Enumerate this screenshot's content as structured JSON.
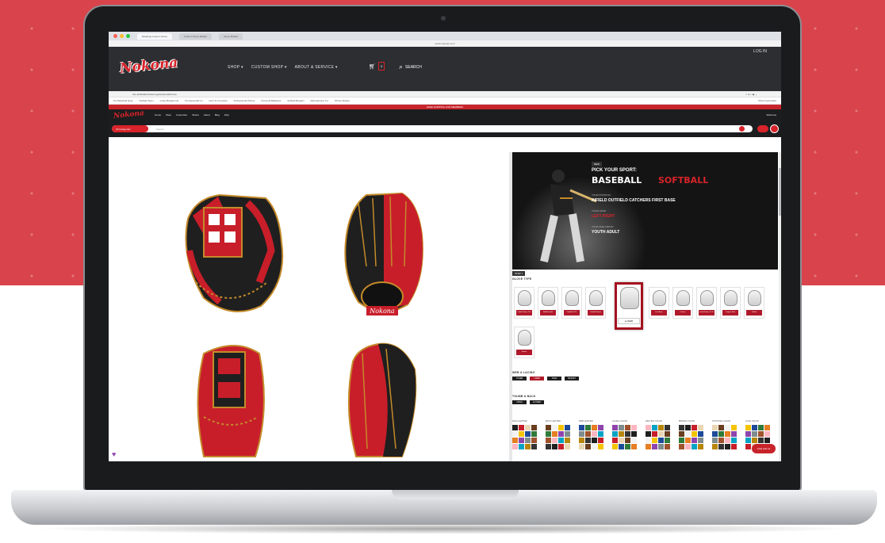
{
  "browser": {
    "tabs": [
      "Rawlings Custom Glove",
      "Custom Glove Builder",
      "Glove Builder"
    ],
    "address_top": "www.example.com",
    "address_bottom": "rdx.net/builder/custom-glove?product=cus",
    "bookmarks": [
      "Pro Baseball Gear",
      "Softball Team",
      "Lucky Bargain Hit",
      "Pro Essential Co",
      "How To Compare",
      "Professional Photos",
      "Personal Ballparks",
      "Softball Bargain",
      "Manufacturer Co",
      "Off the Market"
    ],
    "bookmarks_right": "Other bookmarks"
  },
  "site_header": {
    "logo_text": "Nokona",
    "login": "LOG IN",
    "nav": [
      "SHOP",
      "CUSTOM SHOP",
      "ABOUT & SERVICE"
    ],
    "cart_count": "0",
    "search_label": "SEARCH"
  },
  "promo_bar": "FREE SHIPPING FOR MEMBERS",
  "inner_header": {
    "logo_text": "Nokona",
    "nav": [
      "Home",
      "Shop",
      "Customize",
      "Shorts",
      "About",
      "Blog",
      "FAQ"
    ],
    "account": "Welcome",
    "all_categories": "All Categories",
    "search_placeholder": "Search"
  },
  "banner": {
    "tag": "NEW",
    "pick": "PICK YOUR SPORT:",
    "baseball": "BASEBALL",
    "softball": "SOFTBALL",
    "line1_label": "YOUR POSITION",
    "line1": "INFIELD   OUTFIELD   CATCHERS   FIRST BASE",
    "line2_label": "YOUR HAND",
    "line2": "LEFT  RIGHT",
    "line3_label": "YOUR AGE GROUP",
    "line3": "YOUTH  ADULT"
  },
  "builder": {
    "step_tag": "STEP 1",
    "glove_type_label": "GLOVE TYPE",
    "glove_types": [
      "Infield Pattern 11.5",
      "Middle Infield",
      "Outfield 12.75",
      "Outfield Pattern",
      "First Base",
      "Catcher",
      "Pitcher",
      "Infield Pattern 11.75",
      "Trapeze Web",
      "H-Web",
      "Basket"
    ],
    "active_glove_type": "H-WEB",
    "web_label": "WEB & LACING",
    "web_options": [
      "H-WEB",
      "I-WEB",
      "TRAP",
      "BASKET"
    ],
    "thumb_label": "THUMB & BACK",
    "thumb_options": [
      "OPEN",
      "CLOSED"
    ],
    "swatch_columns": [
      "PALM LEATHER",
      "BACK LEATHER",
      "WEB LEATHER",
      "LACING COLOR",
      "WELTING COLOR",
      "BINDING COLOR",
      "STITCHING COLOR",
      "LOGO COLOR"
    ],
    "chat_button": "Chat with us"
  },
  "colors": {
    "brand_red": "#d8232a",
    "dark": "#1c1d1f",
    "glove_black": "#1f1f1f",
    "glove_red": "#c81e2a",
    "lace_gold": "#c48a2a"
  }
}
